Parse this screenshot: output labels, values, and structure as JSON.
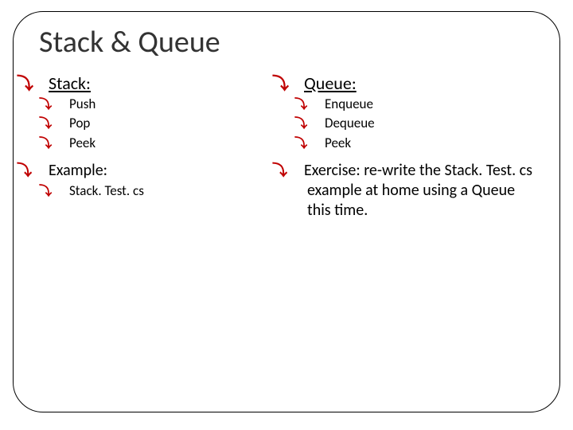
{
  "title": "Stack & Queue",
  "left": {
    "heading": "Stack:",
    "ops": [
      "Push",
      "Pop",
      "Peek"
    ],
    "example_label": "Example:",
    "example_items": [
      "Stack. Test. cs"
    ]
  },
  "right": {
    "heading": "Queue:",
    "ops": [
      "Enqueue",
      "Dequeue",
      "Peek"
    ],
    "exercise_text": "Exercise: re-write  the Stack. Test. cs example at home using a Queue this time."
  },
  "bullet_glyph": "⤵"
}
